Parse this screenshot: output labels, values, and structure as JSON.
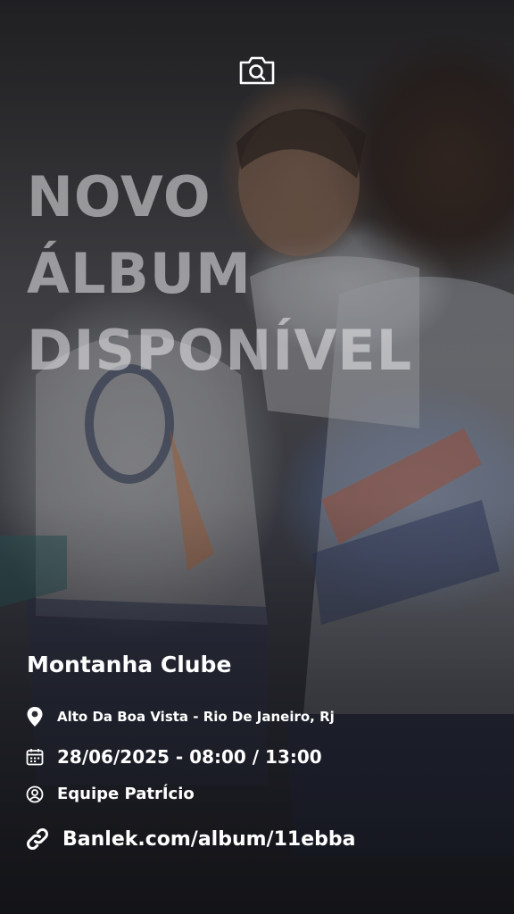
{
  "headline": {
    "line1": "NOVO",
    "line2": "ÁLBUM",
    "line3": "DISPONÍVEL"
  },
  "event": {
    "club_name": "Montanha Clube",
    "location": "Alto Da Boa Vista - Rio De Janeiro, Rj",
    "datetime": "28/06/2025 - 08:00 / 13:00",
    "team": "Equipe PatrÍcio",
    "link": "Banlek.com/album/11ebba"
  },
  "icons": {
    "camera": "camera-search-icon",
    "location": "map-pin-icon",
    "date": "calendar-icon",
    "team": "user-circle-icon",
    "link": "link-icon"
  },
  "colors": {
    "text": "#ffffff",
    "headline": "#ebebee"
  }
}
